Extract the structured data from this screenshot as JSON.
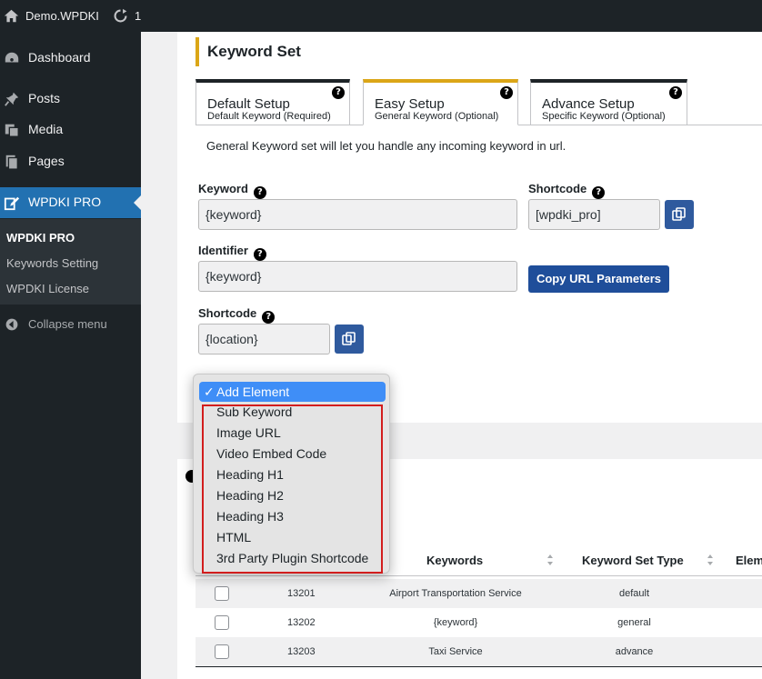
{
  "colors": {
    "accent": "#2271b1",
    "tab_active": "#dba617",
    "button": "#1f4e9a",
    "highlight": "#d21d1d"
  },
  "adminbar": {
    "site_name": "Demo.WPDKI",
    "updates_count": "1",
    "home_icon": "home-icon",
    "updates_icon": "refresh-icon"
  },
  "sidebar": {
    "items": [
      {
        "label": "Dashboard",
        "icon": "dashboard-icon"
      },
      {
        "label": "Posts",
        "icon": "pin-icon"
      },
      {
        "label": "Media",
        "icon": "media-icon"
      },
      {
        "label": "Pages",
        "icon": "pages-icon"
      },
      {
        "label": "WPDKI PRO",
        "icon": "plugin-edit-icon"
      }
    ],
    "submenu": [
      "WPDKI PRO",
      "Keywords Setting",
      "WPDKI License"
    ],
    "collapse_label": "Collapse menu"
  },
  "card": {
    "title": "Keyword Set",
    "tabs": [
      {
        "title": "Default Setup",
        "subtitle": "Default Keyword (Required)"
      },
      {
        "title": "Easy Setup",
        "subtitle": "General Keyword (Optional)"
      },
      {
        "title": "Advance Setup",
        "subtitle": "Specific Keyword (Optional)"
      }
    ],
    "description": "General Keyword set will let you handle any incoming keyword in url.",
    "help_glyph": "?",
    "keyword": {
      "label": "Keyword",
      "value": "{keyword}"
    },
    "shortcode1": {
      "label": "Shortcode",
      "value": "[wpdki_pro]"
    },
    "identifier": {
      "label": "Identifier",
      "value": "{keyword}"
    },
    "copy_url_label": "Copy URL Parameters",
    "shortcode2": {
      "label": "Shortcode",
      "value": "{location}"
    }
  },
  "dropdown": {
    "selected": "Add Element",
    "check": "✓",
    "options": [
      "Sub Keyword",
      "Image URL",
      "Video Embed Code",
      "Heading H1",
      "Heading H2",
      "Heading H3",
      "HTML",
      "3rd Party Plugin Shortcode"
    ]
  },
  "table": {
    "columns": [
      "Keywords",
      "Keyword Set Type",
      "Elem"
    ],
    "rows": [
      {
        "id": "13201",
        "keyword": "Airport Transportation Service",
        "type": "default"
      },
      {
        "id": "13202",
        "keyword": "{keyword}",
        "type": "general"
      },
      {
        "id": "13203",
        "keyword": "Taxi Service",
        "type": "advance"
      }
    ]
  }
}
